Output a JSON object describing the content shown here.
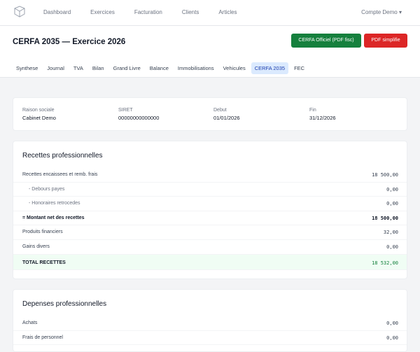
{
  "nav": {
    "items": [
      "Dashboard",
      "Exercices",
      "Facturation",
      "Clients",
      "Articles"
    ],
    "account": "Compte Demo"
  },
  "header": {
    "title": "CERFA 2035 — Exercice 2026",
    "cerfa_button": "CERFA Officiel (PDF fisc)",
    "pdf_button": "PDF simplifie",
    "tabs": [
      "Synthese",
      "Journal",
      "TVA",
      "Bilan",
      "Grand Livre",
      "Balance",
      "Immobilisations",
      "Vehicules",
      "CERFA 2035",
      "FEC"
    ],
    "active_tab": "CERFA 2035"
  },
  "info": {
    "raison_label": "Raison sociale",
    "raison_value": "Cabinet Demo",
    "siret_label": "SIRET",
    "siret_value": "00000000000000",
    "debut_label": "Debut",
    "debut_value": "01/01/2026",
    "fin_label": "Fin",
    "fin_value": "31/12/2026"
  },
  "recettes": {
    "title": "Recettes professionnelles",
    "rows": [
      {
        "label": "Recettes encaissees et remb. frais",
        "value": "18 500,00"
      },
      {
        "label": "- Debours payes",
        "value": "0,00"
      },
      {
        "label": "- Honoraires retrocedes",
        "value": "0,00"
      },
      {
        "label": "= Montant net des recettes",
        "value": "18 500,00"
      },
      {
        "label": "Produits financiers",
        "value": "32,00"
      },
      {
        "label": "Gains divers",
        "value": "0,00"
      },
      {
        "label": "TOTAL RECETTES",
        "value": "18 532,00"
      }
    ]
  },
  "depenses": {
    "title": "Depenses professionnelles",
    "rows": [
      {
        "label": "Achats",
        "value": "0,00"
      },
      {
        "label": "Frais de personnel",
        "value": "0,00"
      }
    ]
  }
}
